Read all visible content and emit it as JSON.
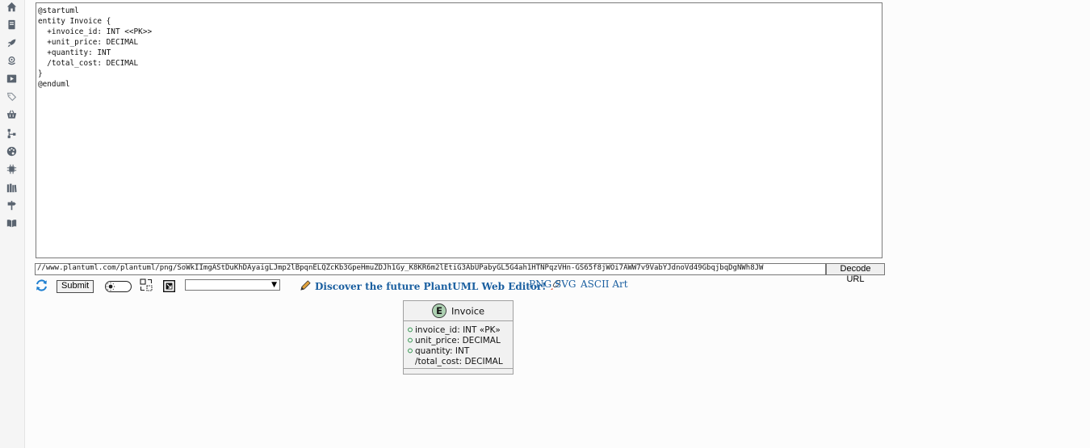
{
  "sidebar": {
    "icons": [
      "home-icon",
      "book-icon",
      "rocket-icon",
      "cloud-icon",
      "play-icon",
      "tags-icon",
      "basket-icon",
      "sitemap-icon",
      "palette-icon",
      "chip-icon",
      "library-icon",
      "signpost-icon",
      "open-book-icon"
    ]
  },
  "editor": {
    "source": "@startuml\nentity Invoice {\n  +invoice_id: INT <<PK>>\n  +unit_price: DECIMAL\n  +quantity: INT\n  /total_cost: DECIMAL\n}\n@enduml"
  },
  "url_bar": {
    "value": "//www.plantuml.com/plantuml/png/SoWkIImgAStDuKhDAyaigLJmp2lBpqnELQZcKb3GpeHmuZDJh1Gy_K8KR6m2lEtiG3AbUPabyGL5G4ah1HTNPqzVHn-GS65f8jWOi7AWW7v9VabYJdnoVd49GbqjbqDgNWh8JW",
    "decode_label": "Decode URL"
  },
  "controls": {
    "submit_label": "Submit",
    "select_value": "",
    "discover_label": "Discover the future PlantUML Web Editor!",
    "formats": [
      "PNG",
      "SVG",
      "ASCII Art"
    ]
  },
  "diagram": {
    "entity_badge": "E",
    "entity_name": "Invoice",
    "fields": [
      {
        "marker": true,
        "text": "invoice_id: INT «PK»"
      },
      {
        "marker": true,
        "text": "unit_price: DECIMAL"
      },
      {
        "marker": true,
        "text": "quantity: INT"
      },
      {
        "marker": false,
        "text": "/total_cost: DECIMAL"
      }
    ]
  },
  "colors": {
    "link": "#1a5fa0",
    "sidebar_icon": "#5a6470",
    "entity_badge_fill": "#add1b2",
    "entity_header_fill": "#f1f1f1",
    "refresh_icon": "#1f7fd0"
  }
}
